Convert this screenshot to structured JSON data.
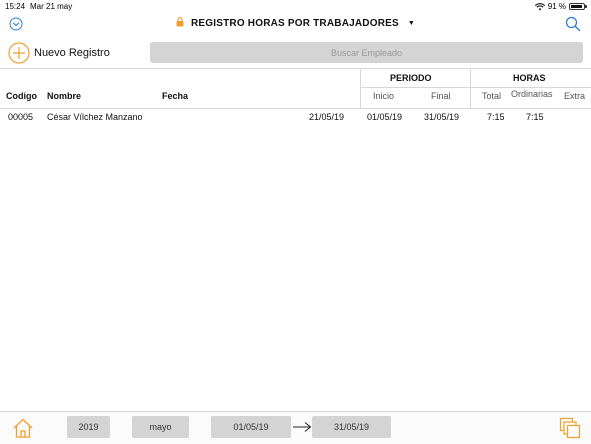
{
  "status": {
    "time": "15:24",
    "date": "Mar 21 may",
    "battery": "91 %",
    "battery_level": 0.91
  },
  "nav": {
    "title": "REGISTRO HORAS POR TRABAJADORES"
  },
  "toolbar": {
    "new_label": "Nuevo Registro",
    "search_placeholder": "Buscar Empleado"
  },
  "table": {
    "headers": {
      "codigo": "Codigo",
      "nombre": "Nombre",
      "fecha": "Fecha",
      "periodo": "PERIODO",
      "inicio": "Inicio",
      "final": "Final",
      "horas": "HORAS",
      "total": "Total",
      "ordinarias": "Ordinarias",
      "extra": "Extra"
    },
    "rows": [
      {
        "codigo": "00005",
        "nombre": "César Vílchez Manzano",
        "fecha": "21/05/19",
        "inicio": "01/05/19",
        "final": "31/05/19",
        "total": "7:15",
        "ordinarias": "7:15",
        "extra": ""
      }
    ]
  },
  "bottom": {
    "year": "2019",
    "month": "mayo",
    "from": "01/05/19",
    "to": "31/05/19"
  },
  "colors": {
    "accent": "#f0a030",
    "blue": "#2f7fd6",
    "pill": "#d4d4d4"
  }
}
